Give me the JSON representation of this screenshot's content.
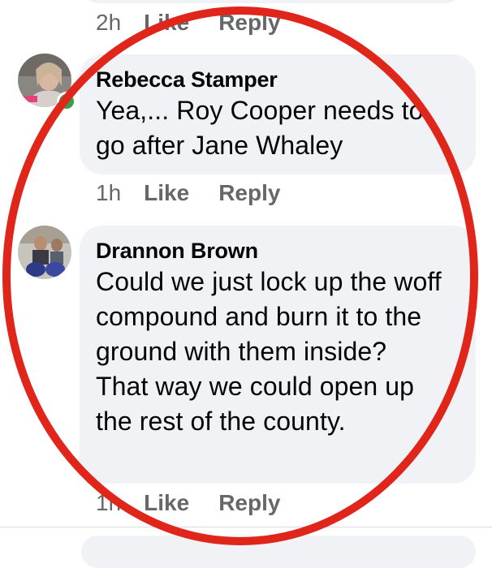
{
  "top_actions": {
    "time": "2h",
    "like": "Like",
    "reply": "Reply"
  },
  "comments": [
    {
      "author": "Rebecca Stamper",
      "text": "Yea,... Roy Cooper needs to go after Jane Whaley",
      "time": "1h",
      "like": "Like",
      "reply": "Reply",
      "online": true
    },
    {
      "author": "Drannon Brown",
      "text": "Could we just lock up the woff compound and burn it to the ground with them inside? That way we could open up the rest of the county.",
      "time": "1h",
      "like": "Like",
      "reply": "Reply",
      "online": false
    }
  ],
  "colors": {
    "annotation_circle": "#e0261b",
    "online": "#31a24c",
    "bubble": "#f0f2f5",
    "meta": "#65676b"
  }
}
